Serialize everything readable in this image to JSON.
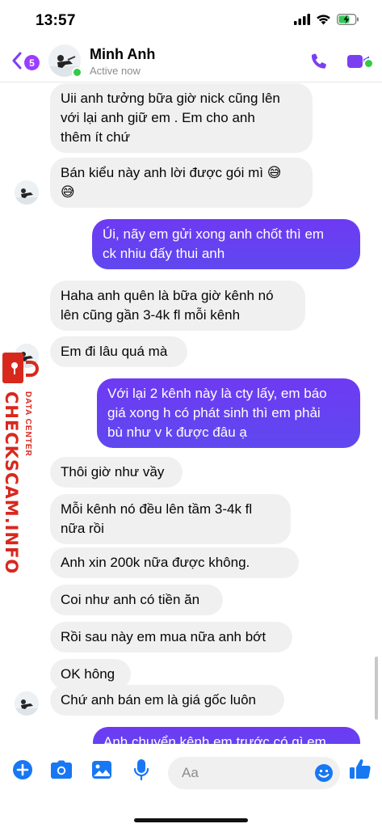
{
  "status_bar": {
    "time": "13:57"
  },
  "header": {
    "unread_count": "5",
    "contact_name": "Minh Anh",
    "contact_status": "Active now"
  },
  "messages": [
    {
      "side": "in",
      "text": [
        "Uii anh tưởng bữa giờ nick cũng lên",
        "với lại anh giữ em . Em cho anh",
        "thêm ít chứ"
      ]
    },
    {
      "side": "in",
      "text": [
        "Bán kiểu này anh lời được gói mì 😅",
        "😅"
      ]
    },
    {
      "side": "out",
      "text": [
        "Úi, nãy em gửi xong anh chốt thì em",
        "ck nhiu đấy thui anh"
      ]
    },
    {
      "side": "in",
      "text": [
        "Haha anh quên là bữa giờ kênh nó",
        "lên cũng gần 3-4k fl mỗi kênh"
      ]
    },
    {
      "side": "in",
      "text": [
        "Em đi lâu quá mà"
      ]
    },
    {
      "side": "out",
      "text": [
        "Với lại 2 kênh này là cty lấy, em báo",
        "giá xong h có phát sinh thì em phải",
        "bù như v k được đâu ạ"
      ]
    },
    {
      "side": "in",
      "text": [
        "Thôi giờ như vầy"
      ]
    },
    {
      "side": "in",
      "text": [
        "Mỗi kênh nó đều lên tầm 3-4k fl",
        "nữa rồi"
      ]
    },
    {
      "side": "in",
      "text": [
        "Anh xin 200k nữa được không."
      ]
    },
    {
      "side": "in",
      "text": [
        "Coi như anh có tiền ăn"
      ]
    },
    {
      "side": "in",
      "text": [
        "Rồi sau này em mua nữa anh bớt"
      ]
    },
    {
      "side": "in",
      "text": [
        "OK hông"
      ]
    },
    {
      "side": "in",
      "text": [
        "Chứ anh bán em là giá gốc luôn"
      ]
    },
    {
      "side": "out",
      "text": [
        "Anh chuyển kênh em trước có gì em"
      ]
    }
  ],
  "watermark": {
    "site": "CHECKSCAM.INFO",
    "tagline": "DATA CENTER"
  },
  "composer": {
    "placeholder": "Aa"
  },
  "colors": {
    "accent": "#7b3ff2",
    "outgoing_start": "#6e3af2",
    "outgoing_end": "#5f48f0",
    "incoming": "#f0f0f0",
    "composer_icons": "#1877f2",
    "online": "#31cc46",
    "watermark": "#d8281e"
  },
  "icons": [
    "back-chevron-icon",
    "phone-icon",
    "video-camera-icon",
    "plus-icon",
    "camera-icon",
    "photo-icon",
    "microphone-icon",
    "emoji-icon",
    "thumbs-up-icon"
  ]
}
